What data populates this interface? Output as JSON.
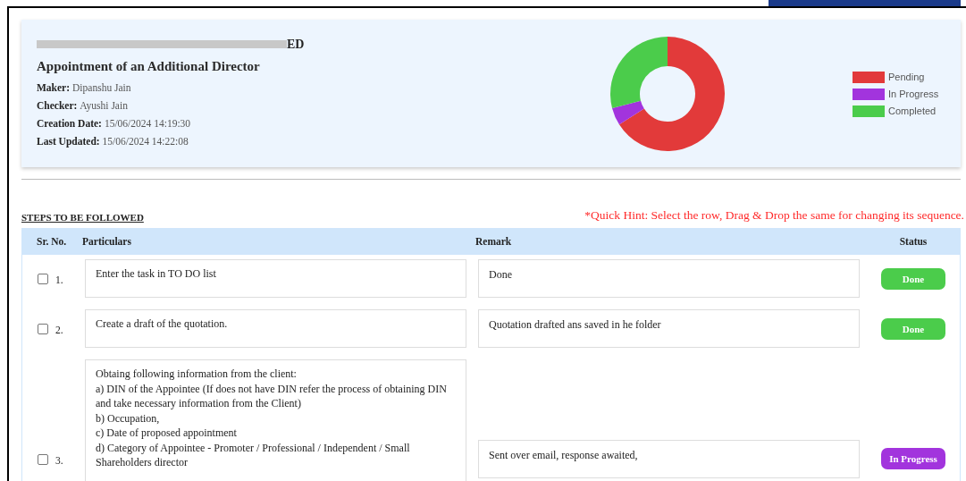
{
  "header": {
    "company_name_tail": "ED",
    "title": "Appointment of an Additional Director",
    "details": [
      {
        "label": "Maker:",
        "value": "Dipanshu Jain"
      },
      {
        "label": "Checker:",
        "value": "Ayushi Jain"
      },
      {
        "label": "Creation Date:",
        "value": "15/06/2024 14:19:30"
      },
      {
        "label": "Last Updated:",
        "value": "15/06/2024 14:22:08"
      }
    ]
  },
  "legend": [
    {
      "label": "Pending",
      "color": "#e23a3a"
    },
    {
      "label": "In Progress",
      "color": "#a234dd"
    },
    {
      "label": "Completed",
      "color": "#4bcc4b"
    }
  ],
  "steps_heading": "STEPS TO BE FOLLOWED",
  "hint": "*Quick Hint: Select the row, Drag & Drop the same for changing its sequence.",
  "table": {
    "columns": [
      "Sr. No.",
      "Particulars",
      "Remark",
      "Status"
    ],
    "rows": [
      {
        "checked": false,
        "number": "1.",
        "particulars": [
          "Enter the task in TO DO list"
        ],
        "remark": "Done",
        "status": {
          "label": "Done",
          "kind": "done"
        }
      },
      {
        "checked": false,
        "number": "2.",
        "particulars": [
          "Create a draft of the quotation."
        ],
        "remark": "Quotation drafted ans saved in he folder",
        "status": {
          "label": "Done",
          "kind": "done"
        }
      },
      {
        "checked": false,
        "number": "3.",
        "particulars": [
          "Obtaing following information from the client:",
          "a) DIN of the Appointee (If does not have DIN refer the process of obtaining DIN and take necessary information from the Client)",
          "b) Occupation,",
          "c) Date of proposed appointment",
          "d) Category of Appointee - Promoter / Professional / Independent / Small Shareholders director"
        ],
        "remark": "Sent over email, response awaited,",
        "status": {
          "label": "In Progress",
          "kind": "in_progress"
        }
      }
    ]
  }
}
